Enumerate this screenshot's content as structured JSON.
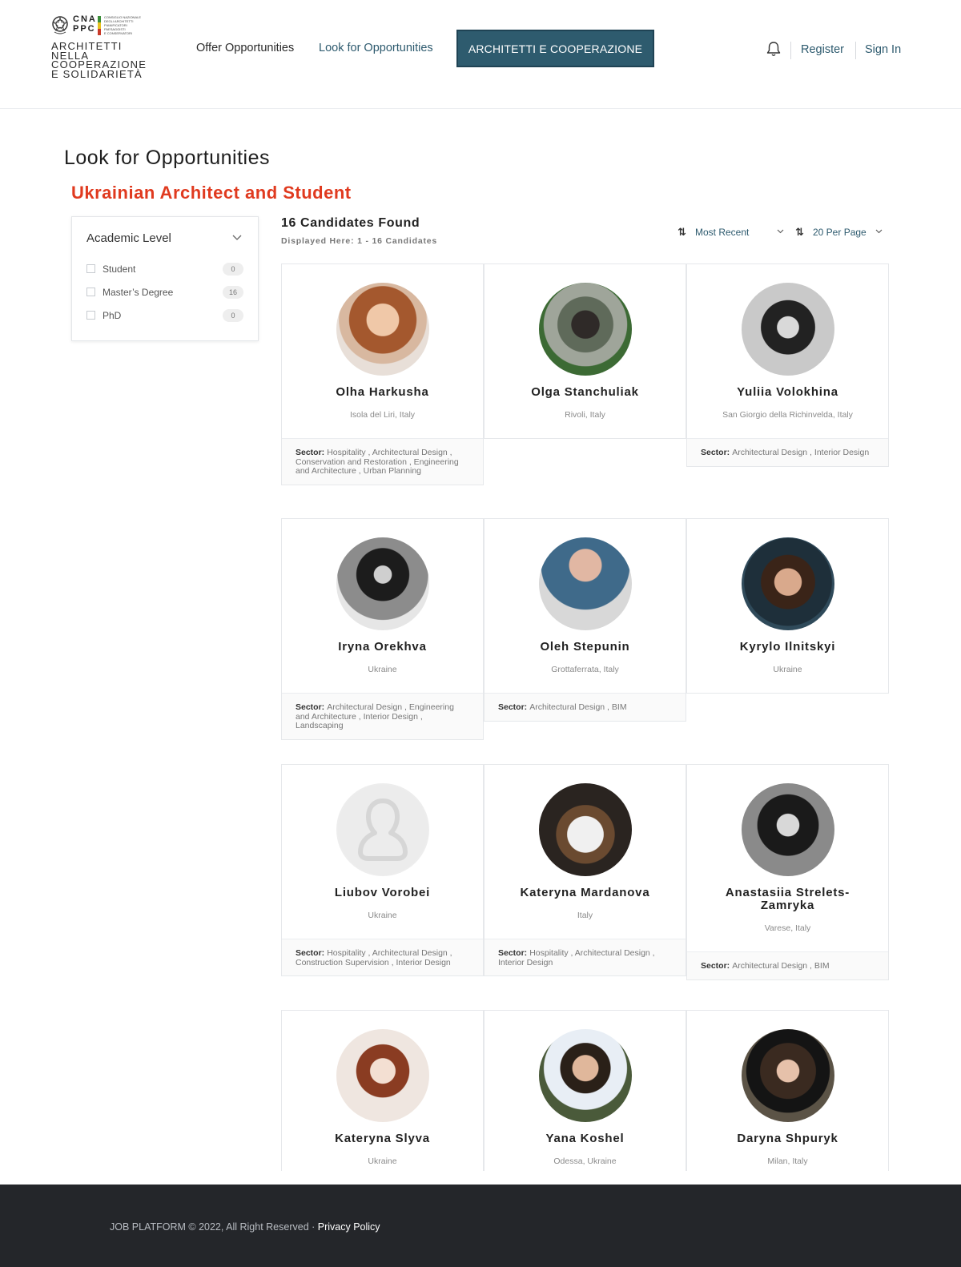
{
  "logo": {
    "cna": "CNA",
    "ppc": "PPC",
    "council_lines": [
      "CONSIGLIO NAZIONALE",
      "DEGLI ARCHITETTI",
      "PIANIFICATORI",
      "PAESAGGISTI",
      "E CONSERVATORI"
    ],
    "org_lines": [
      "ARCHITETTI",
      "NELLA",
      "COOPERAZIONE",
      "E SOLIDARIETÀ"
    ]
  },
  "nav": {
    "offer": "Offer Opportunities",
    "look": "Look for Opportunities",
    "cta": "ARCHITETTI E COOPERAZIONE",
    "register": "Register",
    "signin": "Sign In"
  },
  "page": {
    "title": "Look for Opportunities",
    "subtitle": "Ukrainian Architect and Student"
  },
  "filter": {
    "heading": "Academic Level",
    "options": [
      {
        "label": "Student",
        "count": "0"
      },
      {
        "label": "Master’s Degree",
        "count": "16"
      },
      {
        "label": "PhD",
        "count": "0"
      }
    ]
  },
  "results": {
    "found": "16 Candidates Found",
    "displayed": "Displayed Here: 1 - 16 Candidates",
    "sort_label": "Most Recent",
    "per_page_label": "20 Per Page"
  },
  "sector_label": "Sector:",
  "candidates": [
    {
      "name": "Olha Harkusha",
      "location": "Isola del Liri, Italy",
      "sector": "Hospitality , Architectural Design , Conservation and Restoration , Engineering and Architecture , Urban Planning"
    },
    {
      "name": "Olga Stanchuliak",
      "location": "Rivoli, Italy",
      "sector": ""
    },
    {
      "name": "Yuliia Volokhina",
      "location": "San Giorgio della Richinvelda, Italy",
      "sector": "Architectural Design , Interior Design"
    },
    {
      "name": "Iryna Orekhva",
      "location": "Ukraine",
      "sector": "Architectural Design , Engineering and Architecture , Interior Design , Landscaping"
    },
    {
      "name": "Oleh Stepunin",
      "location": "Grottaferrata, Italy",
      "sector": "Architectural Design , BIM"
    },
    {
      "name": "Kyrylo Ilnitskyi",
      "location": "Ukraine",
      "sector": ""
    },
    {
      "name": "Liubov Vorobei",
      "location": "Ukraine",
      "sector": "Hospitality , Architectural Design , Construction Supervision , Interior Design"
    },
    {
      "name": "Kateryna Mardanova",
      "location": "Italy",
      "sector": "Hospitality , Architectural Design , Interior Design"
    },
    {
      "name": "Anastasiia Strelets-Zamryka",
      "location": "Varese, Italy",
      "sector": "Architectural Design , BIM"
    },
    {
      "name": "Kateryna Slyva",
      "location": "Ukraine",
      "sector": ""
    },
    {
      "name": "Yana Koshel",
      "location": "Odessa, Ukraine",
      "sector": ""
    },
    {
      "name": "Daryna Shpuryk",
      "location": "Milan, Italy",
      "sector": ""
    }
  ],
  "footer": {
    "copyright": "JOB PLATFORM © 2022, All Right Reserved · ",
    "privacy": "Privacy Policy"
  },
  "colors": {
    "accent": "#2e5b6e",
    "subtitle_red": "#e03a1f",
    "footer_bg": "#24262a"
  },
  "icons": [
    "bell-icon",
    "chevron-down-icon",
    "sort-icon",
    "checkbox-icon",
    "avatar-placeholder-icon"
  ]
}
